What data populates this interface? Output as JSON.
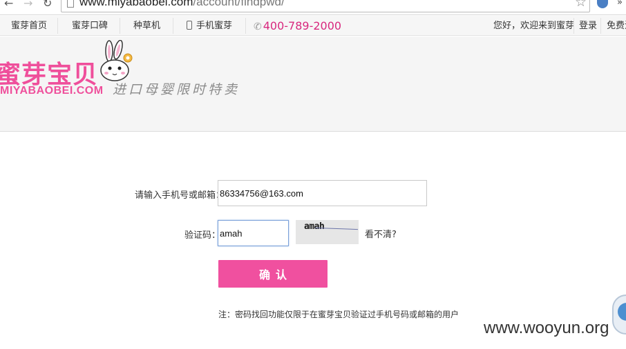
{
  "browser": {
    "url_host": "www.miyabaobei.com",
    "url_path": "/account/findpwd/",
    "back_icon": "arrow-left",
    "forward_icon": "arrow-right",
    "reload_icon": "reload",
    "bookmark_icon": "star-outline",
    "more_label": "»"
  },
  "topbar": {
    "items": [
      "蜜芽首页",
      "蜜芽口碑",
      "种草机",
      "手机蜜芽"
    ],
    "phone": "400-789-2000",
    "greeting": "您好，欢迎来到蜜芽",
    "login": "登录",
    "register": "免费注"
  },
  "header": {
    "logo_cn": "蜜芽宝贝",
    "logo_en": "MIYABAOBEI.COM",
    "slogan": "进口母婴限时特卖"
  },
  "form": {
    "account_label": "请输入手机号或邮箱：",
    "account_value": "86334756@163.com",
    "captcha_label": "验证码：",
    "captcha_value": "amah",
    "captcha_image_text": "amah",
    "refresh_label": "看不清?",
    "submit_label": "确认",
    "note": "注：密码找回功能仅限于在蜜芽宝贝验证过手机号码或邮箱的用户"
  },
  "watermark": "www.wooyun.org",
  "colors": {
    "brand_pink": "#f0509f",
    "phone_pink": "#d8287e",
    "header_bg": "#f5f5f5"
  }
}
